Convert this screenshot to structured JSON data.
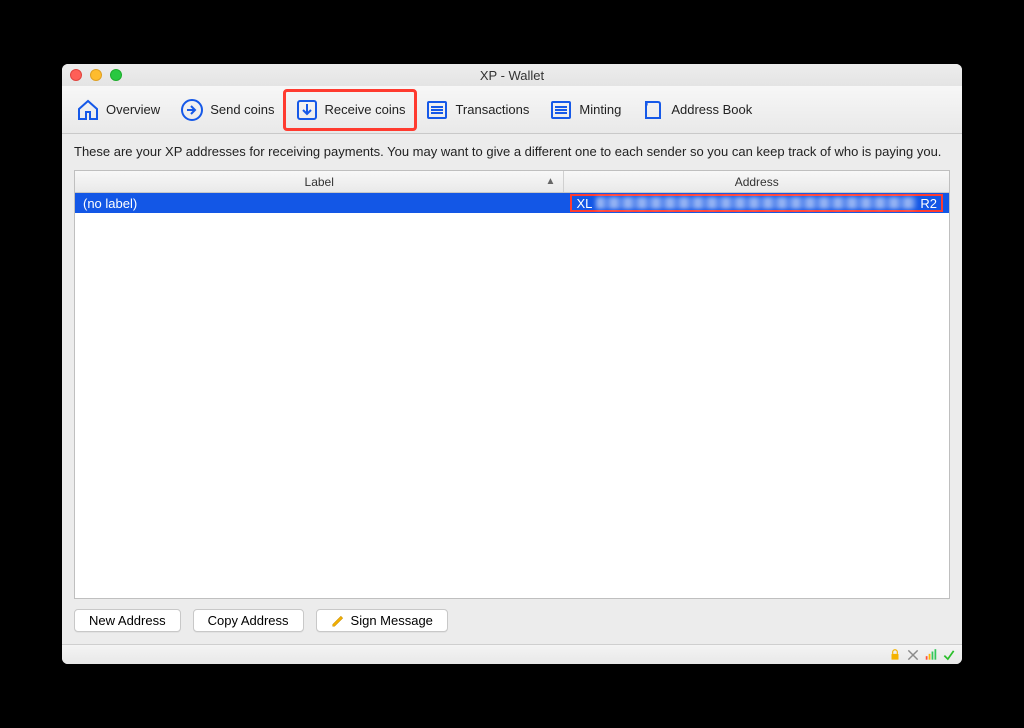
{
  "window": {
    "title": "XP - Wallet"
  },
  "toolbar": {
    "overview": "Overview",
    "send": "Send coins",
    "receive": "Receive coins",
    "transactions": "Transactions",
    "minting": "Minting",
    "addressbook": "Address Book"
  },
  "description": "These are your XP addresses for receiving payments. You may want to give a different one to each sender so you can keep track of who is paying you.",
  "table": {
    "headers": {
      "label": "Label",
      "address": "Address"
    },
    "sort_column": "label",
    "rows": [
      {
        "label": "(no label)",
        "address_prefix": "XL",
        "address_suffix": "R2"
      }
    ]
  },
  "buttons": {
    "new_address": "New Address",
    "copy_address": "Copy Address",
    "sign_message": "Sign Message"
  },
  "status_icons": [
    "lock-icon",
    "tools-icon",
    "signal-icon",
    "check-icon"
  ]
}
